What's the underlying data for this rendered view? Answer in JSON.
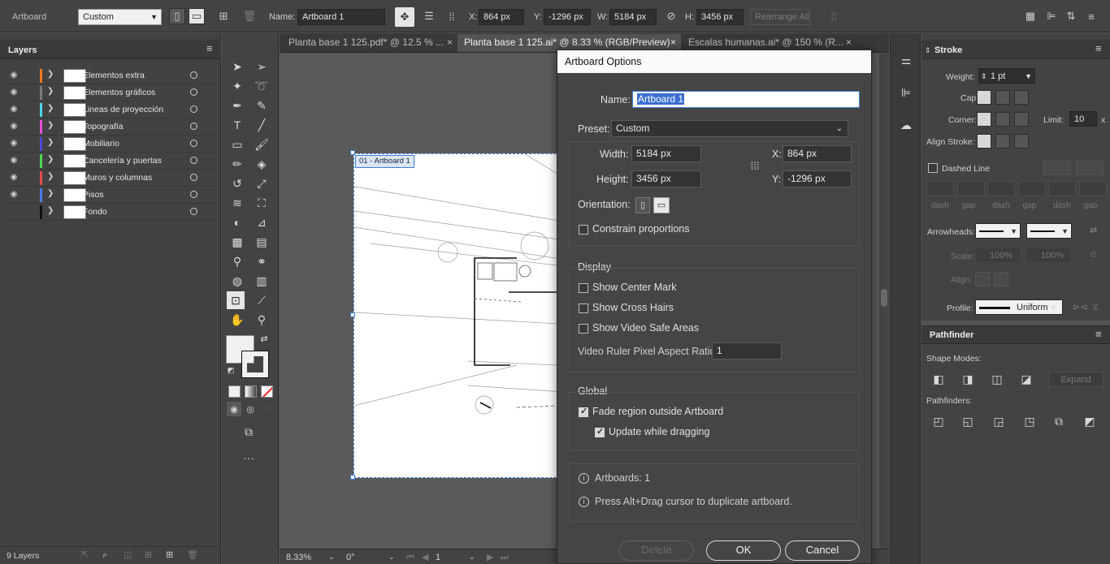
{
  "control_bar": {
    "context_label": "Artboard",
    "preset_value": "Custom",
    "name_label": "Name:",
    "name_value": "Artboard 1",
    "x_label": "X:",
    "x_value": "864 px",
    "y_label": "Y:",
    "y_value": "-1296 px",
    "w_label": "W:",
    "w_value": "5184 px",
    "h_label": "H:",
    "h_value": "3456 px",
    "rearrange_label": "Rearrange All"
  },
  "layers_panel": {
    "title": "Layers",
    "count_label": "9 Layers",
    "layers": [
      {
        "name": "Elementos extra",
        "color": "#f07a1e",
        "visible": true
      },
      {
        "name": "Elementos gráficos",
        "color": "#7a7a7a",
        "visible": true
      },
      {
        "name": "Lineas de proyección",
        "color": "#4fd6e8",
        "visible": true
      },
      {
        "name": "Topografía",
        "color": "#e84fd2",
        "visible": true
      },
      {
        "name": "Mobiliario",
        "color": "#4a4ad8",
        "visible": true
      },
      {
        "name": "Cancelería y puertas",
        "color": "#4fd64f",
        "visible": true
      },
      {
        "name": "Muros y columnas",
        "color": "#e84a4a",
        "visible": true
      },
      {
        "name": "Pisos",
        "color": "#4a7ae8",
        "visible": true
      },
      {
        "name": "Fondo",
        "color": "#111111",
        "visible": false
      }
    ]
  },
  "tabs": [
    {
      "label": "Planta base 1 125.pdf* @ 12.5 % ...",
      "active": false
    },
    {
      "label": "Planta base 1 125.ai* @ 8.33 % (RGB/Preview)",
      "active": true
    },
    {
      "label": "Escalas humanas.ai* @ 150 % (R...",
      "active": false
    }
  ],
  "canvas": {
    "artboard_label": "01 - Artboard 1"
  },
  "status_bar": {
    "zoom": "8.33%",
    "rotation": "0°",
    "artboard_number": "1"
  },
  "dialog": {
    "title": "Artboard Options",
    "name_label": "Name:",
    "name_value": "Artboard 1",
    "preset_label": "Preset:",
    "preset_value": "Custom",
    "width_label": "Width:",
    "width_value": "5184 px",
    "height_label": "Height:",
    "height_value": "3456 px",
    "x_label": "X:",
    "x_value": "864 px",
    "y_label": "Y:",
    "y_value": "-1296 px",
    "orientation_label": "Orientation:",
    "constrain_label": "Constrain proportions",
    "display_title": "Display",
    "show_center_mark": "Show Center Mark",
    "show_cross_hairs": "Show Cross Hairs",
    "show_video_safe": "Show Video Safe Areas",
    "ruler_aspect_label": "Video Ruler Pixel Aspect Ratio:",
    "ruler_aspect_value": "1",
    "global_title": "Global",
    "fade_region": "Fade region outside Artboard",
    "update_dragging": "Update while dragging",
    "artboards_count": "Artboards: 1",
    "alt_drag_hint": "Press Alt+Drag cursor to duplicate artboard.",
    "delete_label": "Delete",
    "ok_label": "OK",
    "cancel_label": "Cancel"
  },
  "stroke_panel": {
    "title": "Stroke",
    "weight_label": "Weight:",
    "weight_value": "1 pt",
    "cap_label": "Cap:",
    "corner_label": "Corner:",
    "limit_label": "Limit:",
    "limit_value": "10",
    "limit_suffix": "x",
    "align_label": "Align Stroke:",
    "dashed_label": "Dashed Line",
    "dash_labels": [
      "dash",
      "gap",
      "dash",
      "gap",
      "dash",
      "gap"
    ],
    "arrowheads_label": "Arrowheads:",
    "scale_label": "Scale:",
    "scale_1": "100%",
    "scale_2": "100%",
    "align_arrow_label": "Align:",
    "profile_label": "Profile:",
    "profile_value": "Uniform"
  },
  "pathfinder_panel": {
    "title": "Pathfinder",
    "shape_modes_label": "Shape Modes:",
    "expand_label": "Expand",
    "pathfinders_label": "Pathfinders:"
  }
}
